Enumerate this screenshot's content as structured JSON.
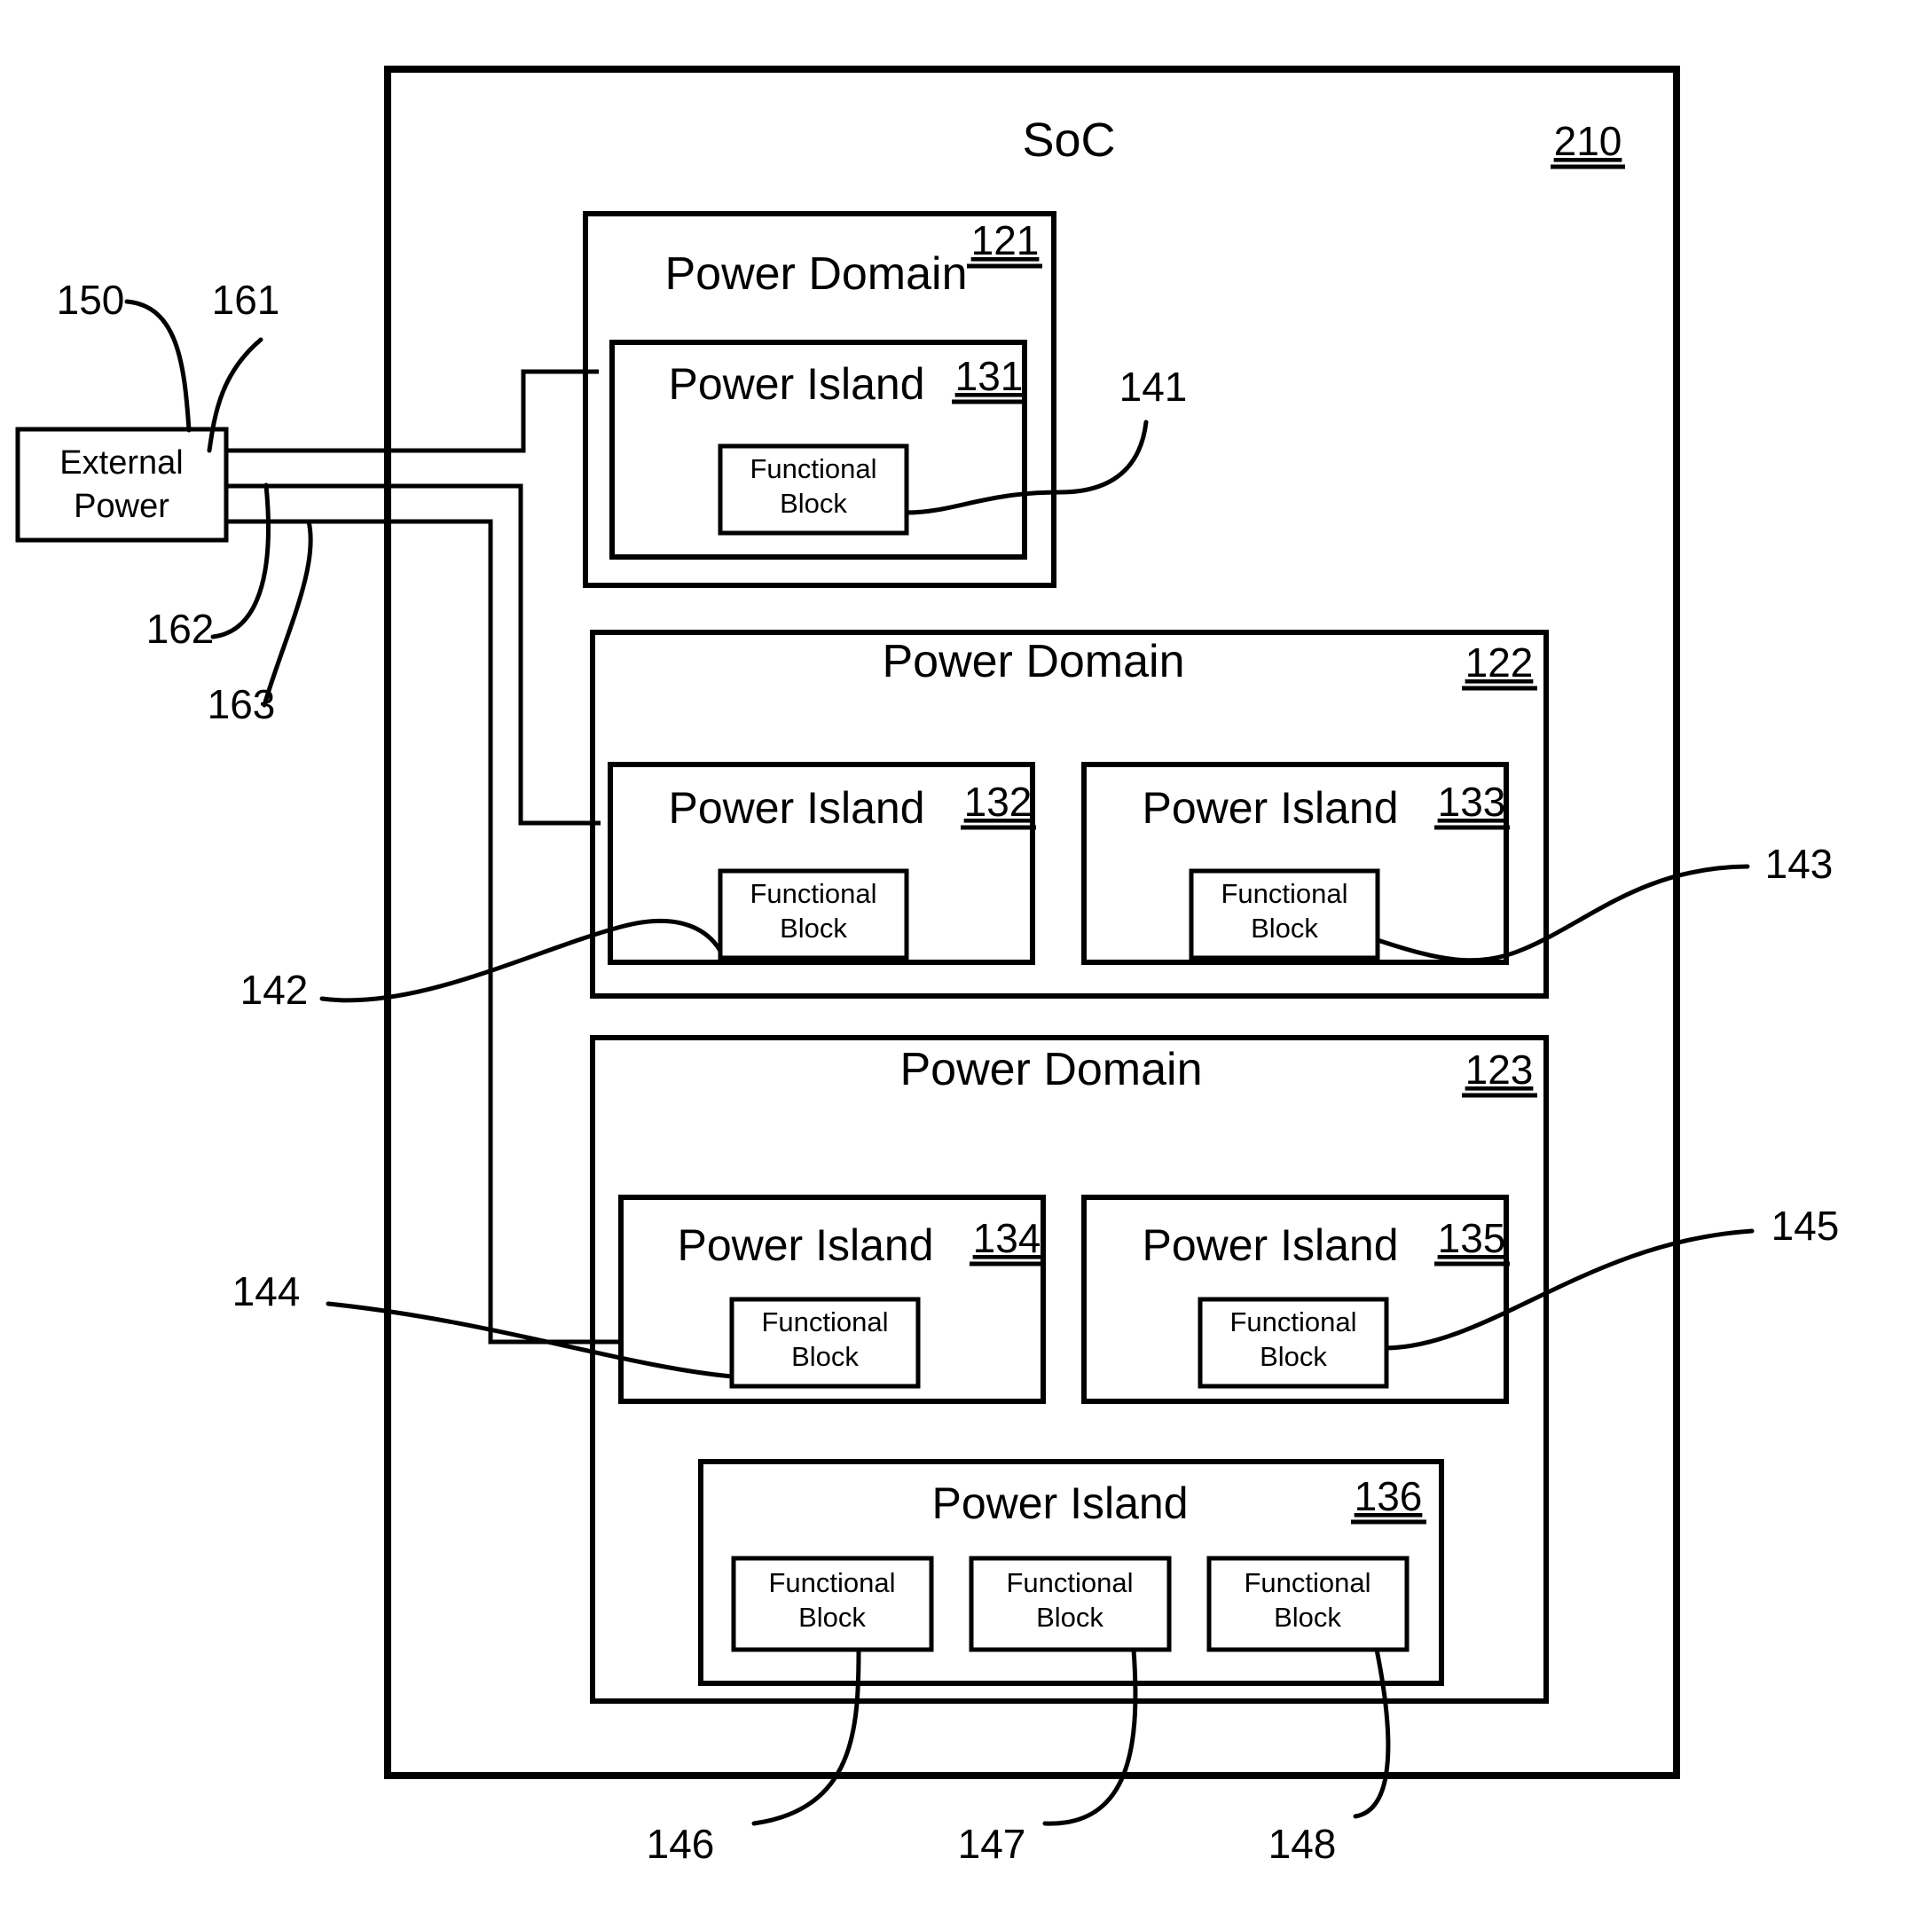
{
  "figure": {
    "title": "SoC",
    "soc_ref": "210"
  },
  "external_power": {
    "line1": "External",
    "line2": "Power",
    "ref": "150"
  },
  "power_rails": [
    {
      "ref": "161"
    },
    {
      "ref": "162"
    },
    {
      "ref": "163"
    }
  ],
  "domains": [
    {
      "label": "Power Domain",
      "ref": "121",
      "islands": [
        {
          "label": "Power Island",
          "ref": "131",
          "blocks": [
            {
              "line1": "Functional",
              "line2": "Block",
              "callout": "141"
            }
          ]
        }
      ]
    },
    {
      "label": "Power Domain",
      "ref": "122",
      "islands": [
        {
          "label": "Power Island",
          "ref": "132",
          "blocks": [
            {
              "line1": "Functional",
              "line2": "Block",
              "callout": "142"
            }
          ]
        },
        {
          "label": "Power Island",
          "ref": "133",
          "blocks": [
            {
              "line1": "Functional",
              "line2": "Block",
              "callout": "143"
            }
          ]
        }
      ]
    },
    {
      "label": "Power Domain",
      "ref": "123",
      "islands": [
        {
          "label": "Power Island",
          "ref": "134",
          "blocks": [
            {
              "line1": "Functional",
              "line2": "Block",
              "callout": "144"
            }
          ]
        },
        {
          "label": "Power Island",
          "ref": "135",
          "blocks": [
            {
              "line1": "Functional",
              "line2": "Block",
              "callout": "145"
            }
          ]
        },
        {
          "label": "Power Island",
          "ref": "136",
          "blocks": [
            {
              "line1": "Functional",
              "line2": "Block",
              "callout": "146"
            },
            {
              "line1": "Functional",
              "line2": "Block",
              "callout": "147"
            },
            {
              "line1": "Functional",
              "line2": "Block",
              "callout": "148"
            }
          ]
        }
      ]
    }
  ],
  "callouts": {
    "c141": "141",
    "c142": "142",
    "c143": "143",
    "c144": "144",
    "c145": "145",
    "c146": "146",
    "c147": "147",
    "c148": "148",
    "c150": "150",
    "c161": "161",
    "c162": "162",
    "c163": "163",
    "c210": "210"
  },
  "colors": {
    "line": "#000000",
    "background": "#ffffff"
  }
}
